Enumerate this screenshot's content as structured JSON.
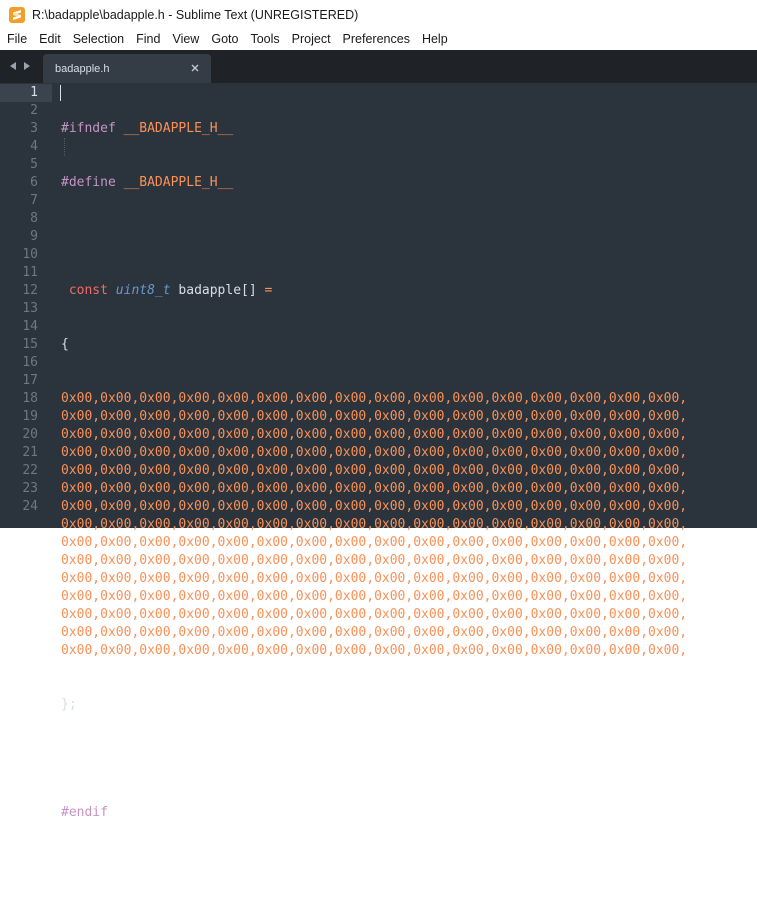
{
  "window": {
    "title": "R:\\badapple\\badapple.h - Sublime Text (UNREGISTERED)"
  },
  "menu": [
    "File",
    "Edit",
    "Selection",
    "Find",
    "View",
    "Goto",
    "Tools",
    "Project",
    "Preferences",
    "Help"
  ],
  "tabs": [
    {
      "label": "badapple.h",
      "active": true
    }
  ],
  "editor": {
    "current_line": 1,
    "line_numbers": [
      "1",
      "2",
      "3",
      "4",
      "5",
      "6",
      "7",
      "8",
      "9",
      "10",
      "11",
      "12",
      "13",
      "14",
      "15",
      "16",
      "17",
      "18",
      "19",
      "20",
      "21",
      "22",
      "23",
      "24"
    ],
    "lines": {
      "l1_directive": "#ifndef",
      "l1_macro": "__BADAPPLE_H__",
      "l2_directive": "#define",
      "l2_macro": "__BADAPPLE_H__",
      "l4_storage": "const",
      "l4_type": "uint8_t",
      "l4_name": "badapple[]",
      "l4_op": "=",
      "l5_text": "{",
      "data_row": "0x00,0x00,0x00,0x00,0x00,0x00,0x00,0x00,0x00,0x00,0x00,0x00,0x00,0x00,0x00,0x00,",
      "data_row_count": 15,
      "l21_text": "};",
      "l23_directive": "#endif"
    }
  },
  "colors": {
    "editor_bg": "#2b333c",
    "tabbar_bg": "#1f2328",
    "tab_active_bg": "#343d46",
    "preprocessor": "#c594c5",
    "number": "#f99157",
    "type": "#6699cc",
    "app_icon": "#f0a028"
  }
}
